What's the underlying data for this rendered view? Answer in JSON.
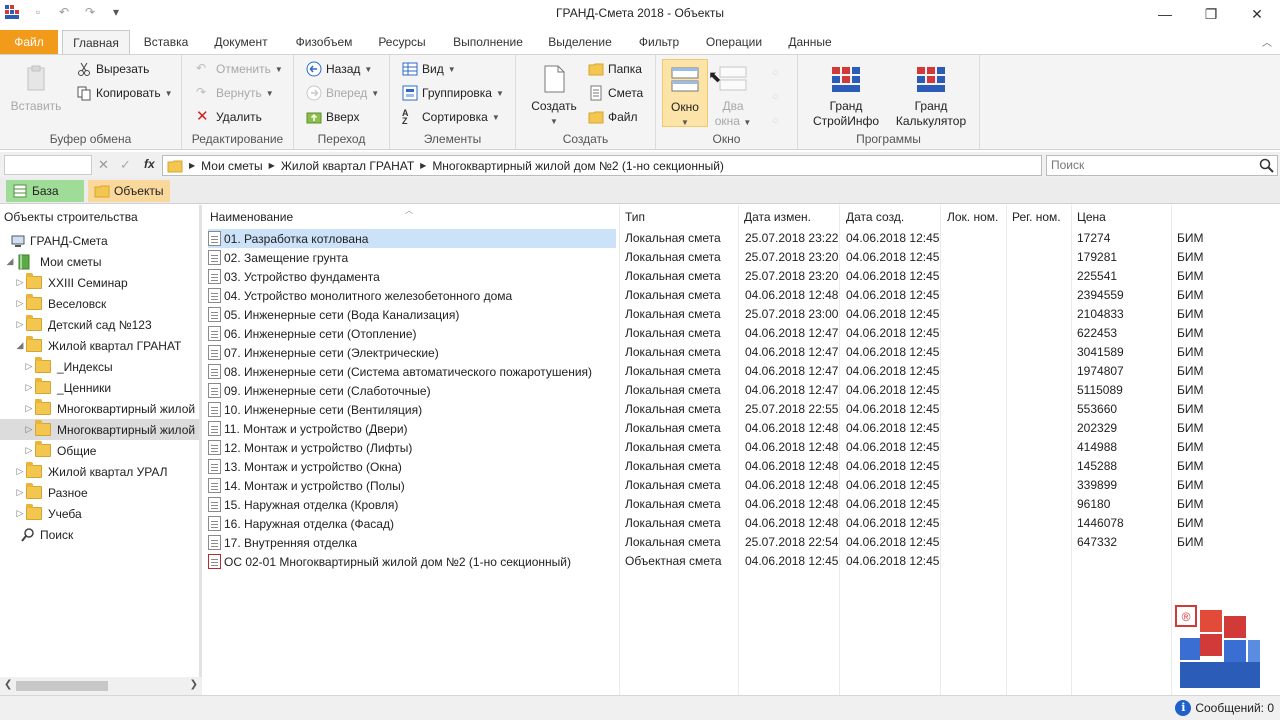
{
  "window": {
    "title": "ГРАНД-Смета 2018 - Объекты"
  },
  "tabs": [
    "Файл",
    "Главная",
    "Вставка",
    "Документ",
    "Физобъем",
    "Ресурсы",
    "Выполнение",
    "Выделение",
    "Фильтр",
    "Операции",
    "Данные"
  ],
  "ribbon": {
    "clipboard": {
      "label": "Буфер обмена",
      "paste": "Вставить",
      "cut": "Вырезать",
      "copy": "Копировать"
    },
    "edit": {
      "label": "Редактирование",
      "undo": "Отменить",
      "redo": "Вернуть",
      "delete": "Удалить"
    },
    "nav": {
      "label": "Переход",
      "back": "Назад",
      "forward": "Вперед",
      "up": "Вверх"
    },
    "elements": {
      "label": "Элементы",
      "view": "Вид",
      "group": "Группировка",
      "sort": "Сортировка"
    },
    "create": {
      "label": "Создать",
      "create": "Создать",
      "folder": "Папка",
      "estimate": "Смета",
      "file": "Файл"
    },
    "window": {
      "label": "Окно",
      "window_line1": "Окно",
      "two_line1": "Два",
      "two_line2": "окна"
    },
    "programs": {
      "label": "Программы",
      "info_line1": "Гранд",
      "info_line2": "СтройИнфо",
      "calc_line1": "Гранд",
      "calc_line2": "Калькулятор"
    }
  },
  "address": {
    "fx": "fx",
    "crumbs": [
      "Мои сметы",
      "Жилой квартал ГРАНАТ",
      "Многоквартирный жилой дом №2 (1-но секционный)"
    ],
    "search_placeholder": "Поиск"
  },
  "doctabs": [
    "База",
    "Объекты"
  ],
  "tree": {
    "header": "Объекты строительства",
    "items": [
      {
        "label": "ГРАНД-Смета"
      },
      {
        "label": "Мои сметы"
      },
      {
        "label": "XXIII Семинар"
      },
      {
        "label": "Веселовск"
      },
      {
        "label": "Детский сад №123"
      },
      {
        "label": "Жилой квартал ГРАНАТ"
      },
      {
        "label": "_Индексы"
      },
      {
        "label": "_Ценники"
      },
      {
        "label": "Многоквартирный жилой"
      },
      {
        "label": "Многоквартирный жилой"
      },
      {
        "label": "Общие"
      },
      {
        "label": "Жилой квартал УРАЛ"
      },
      {
        "label": "Разное"
      },
      {
        "label": "Учеба"
      },
      {
        "label": "Поиск"
      }
    ]
  },
  "grid": {
    "columns": [
      "Наименование",
      "Тип",
      "Дата измен.",
      "Дата созд.",
      "Лок. ном.",
      "Рег. ном.",
      "Цена"
    ],
    "rows": [
      {
        "name": "01. Разработка котлована",
        "type": "Локальная смета",
        "modified": "25.07.2018 23:22",
        "created": "04.06.2018 12:45",
        "price": "17274",
        "tag": "БИМ"
      },
      {
        "name": "02. Замещение грунта",
        "type": "Локальная смета",
        "modified": "25.07.2018 23:20",
        "created": "04.06.2018 12:45",
        "price": "179281",
        "tag": "БИМ"
      },
      {
        "name": "03. Устройство фундамента",
        "type": "Локальная смета",
        "modified": "25.07.2018 23:20",
        "created": "04.06.2018 12:45",
        "price": "225541",
        "tag": "БИМ"
      },
      {
        "name": "04. Устройство монолитного железобетонного дома",
        "type": "Локальная смета",
        "modified": "04.06.2018 12:48",
        "created": "04.06.2018 12:45",
        "price": "2394559",
        "tag": "БИМ"
      },
      {
        "name": "05. Инженерные сети (Вода Канализация)",
        "type": "Локальная смета",
        "modified": "25.07.2018 23:00",
        "created": "04.06.2018 12:45",
        "price": "2104833",
        "tag": "БИМ"
      },
      {
        "name": "06. Инженерные сети (Отопление)",
        "type": "Локальная смета",
        "modified": "04.06.2018 12:47",
        "created": "04.06.2018 12:45",
        "price": "622453",
        "tag": "БИМ"
      },
      {
        "name": "07. Инженерные сети (Электрические)",
        "type": "Локальная смета",
        "modified": "04.06.2018 12:47",
        "created": "04.06.2018 12:45",
        "price": "3041589",
        "tag": "БИМ"
      },
      {
        "name": "08. Инженерные сети (Система автоматического пожаротушения)",
        "type": "Локальная смета",
        "modified": "04.06.2018 12:47",
        "created": "04.06.2018 12:45",
        "price": "1974807",
        "tag": "БИМ"
      },
      {
        "name": "09. Инженерные сети (Слаботочные)",
        "type": "Локальная смета",
        "modified": "04.06.2018 12:47",
        "created": "04.06.2018 12:45",
        "price": "5115089",
        "tag": "БИМ"
      },
      {
        "name": "10. Инженерные сети (Вентиляция)",
        "type": "Локальная смета",
        "modified": "25.07.2018 22:55",
        "created": "04.06.2018 12:45",
        "price": "553660",
        "tag": "БИМ"
      },
      {
        "name": "11. Монтаж и устройство (Двери)",
        "type": "Локальная смета",
        "modified": "04.06.2018 12:48",
        "created": "04.06.2018 12:45",
        "price": "202329",
        "tag": "БИМ"
      },
      {
        "name": "12. Монтаж и устройство (Лифты)",
        "type": "Локальная смета",
        "modified": "04.06.2018 12:48",
        "created": "04.06.2018 12:45",
        "price": "414988",
        "tag": "БИМ"
      },
      {
        "name": "13. Монтаж и устройство (Окна)",
        "type": "Локальная смета",
        "modified": "04.06.2018 12:48",
        "created": "04.06.2018 12:45",
        "price": "145288",
        "tag": "БИМ"
      },
      {
        "name": "14. Монтаж и устройство (Полы)",
        "type": "Локальная смета",
        "modified": "04.06.2018 12:48",
        "created": "04.06.2018 12:45",
        "price": "339899",
        "tag": "БИМ"
      },
      {
        "name": "15. Наружная отделка (Кровля)",
        "type": "Локальная смета",
        "modified": "04.06.2018 12:48",
        "created": "04.06.2018 12:45",
        "price": "96180",
        "tag": "БИМ"
      },
      {
        "name": "16. Наружная отделка (Фасад)",
        "type": "Локальная смета",
        "modified": "04.06.2018 12:48",
        "created": "04.06.2018 12:45",
        "price": "1446078",
        "tag": "БИМ"
      },
      {
        "name": "17. Внутренняя отделка",
        "type": "Локальная смета",
        "modified": "25.07.2018 22:54",
        "created": "04.06.2018 12:45",
        "price": "647332",
        "tag": "БИМ"
      },
      {
        "name": "ОС 02-01 Многоквартирный жилой дом №2 (1-но секционный)",
        "type": "Объектная смета",
        "modified": "04.06.2018 12:45",
        "created": "04.06.2018 12:45",
        "price": "",
        "tag": ""
      }
    ]
  },
  "status": {
    "messages": "Сообщений: 0"
  },
  "colors": {
    "file_tab": "#f29a1a",
    "baza_tab": "#9fdc98",
    "objects_tab": "#fad79a",
    "selection": "#cce2f8"
  }
}
